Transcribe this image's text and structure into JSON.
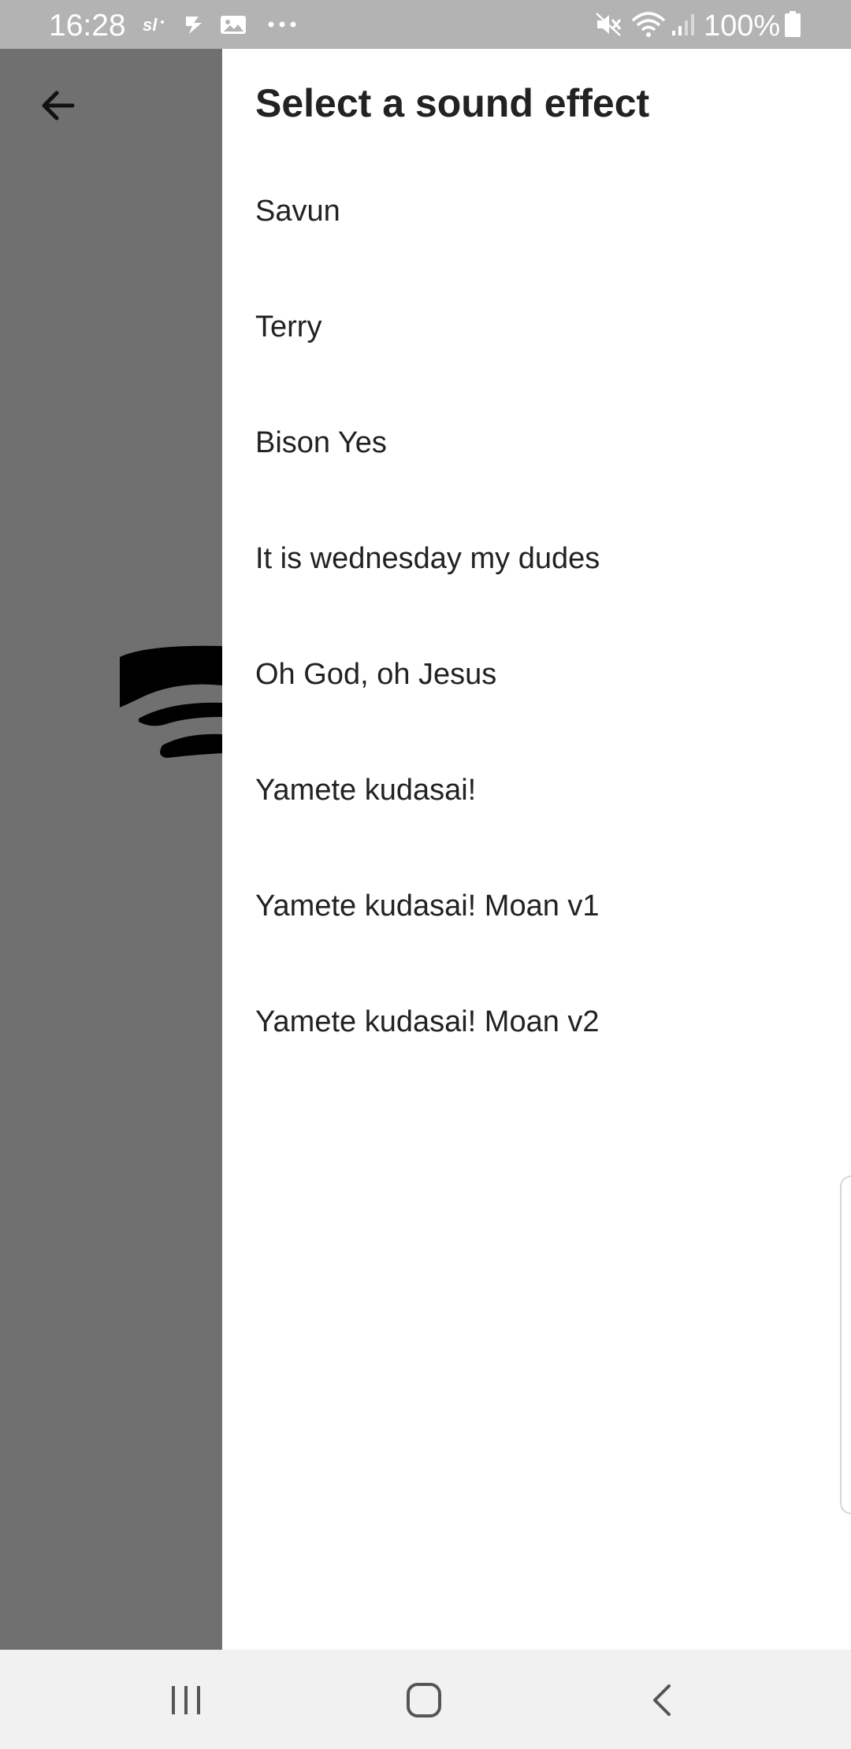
{
  "status_bar": {
    "time": "16:28",
    "battery_percent": "100%",
    "notification_icons": [
      "sl-app-icon",
      "checkmark-app-icon",
      "gallery-app-icon",
      "more-dots-icon"
    ],
    "system_icons": [
      "mute-icon",
      "wifi-icon",
      "signal-icon",
      "battery-icon"
    ]
  },
  "background_app": {
    "back_icon": "arrow-left-icon"
  },
  "drawer": {
    "title": "Select a sound effect",
    "items": [
      {
        "label": "Savun"
      },
      {
        "label": "Terry"
      },
      {
        "label": "Bison Yes"
      },
      {
        "label": "It is wednesday my dudes"
      },
      {
        "label": "Oh God, oh Jesus"
      },
      {
        "label": "Yamete kudasai!"
      },
      {
        "label": "Yamete kudasai! Moan v1"
      },
      {
        "label": "Yamete kudasai! Moan v2"
      }
    ]
  },
  "nav_bar": {
    "buttons": [
      "recent-apps-icon",
      "home-icon",
      "back-icon"
    ]
  },
  "colors": {
    "status_bar_bg": "#b3b3b3",
    "scrim_bg": "#707070",
    "drawer_bg": "#ffffff",
    "text": "#222222",
    "nav_bar_bg": "#f1f1f1"
  }
}
